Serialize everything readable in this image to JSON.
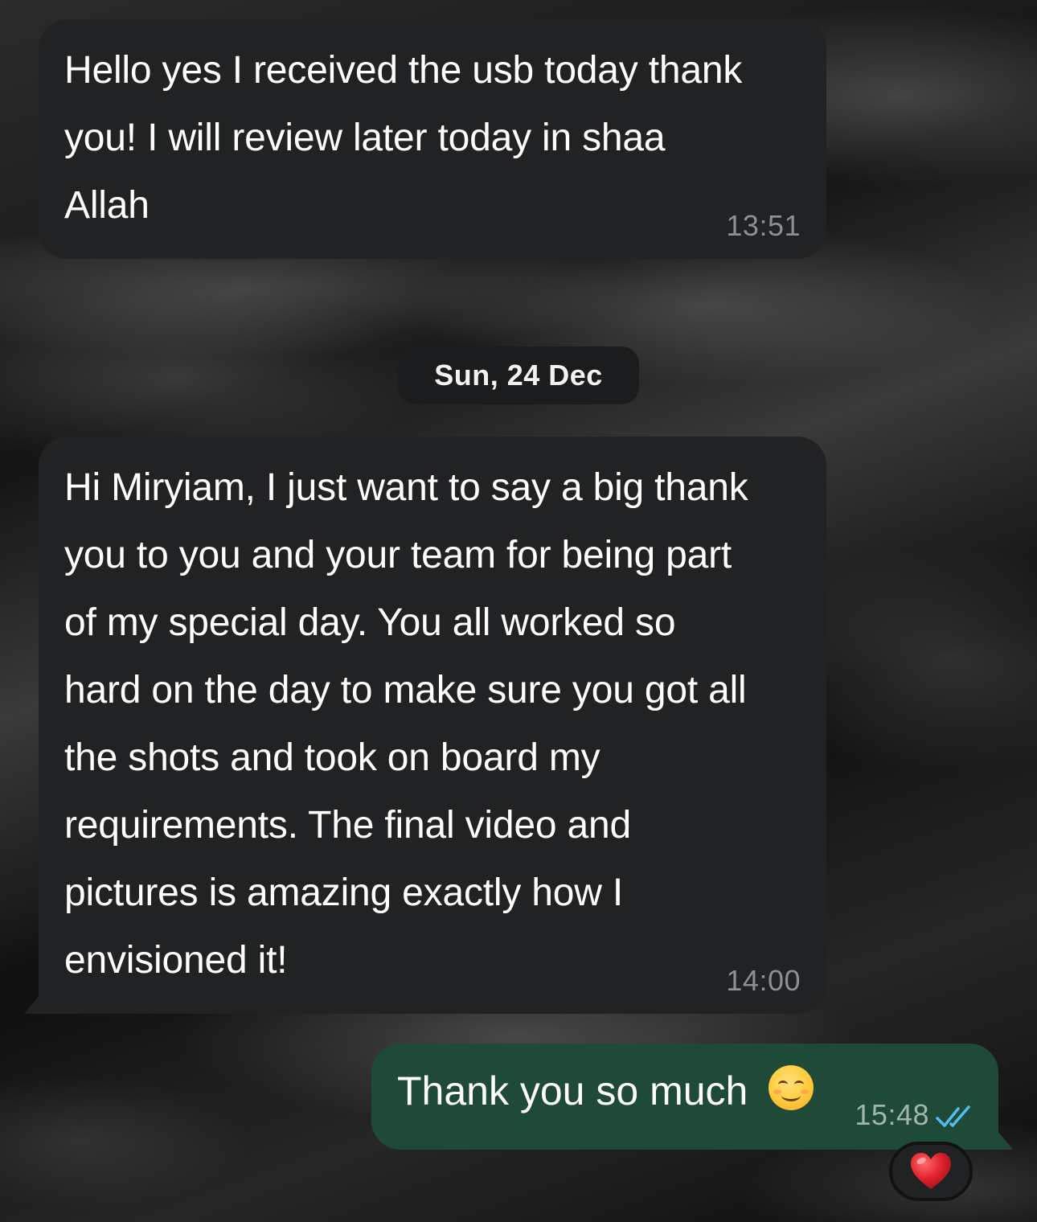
{
  "messages": [
    {
      "direction": "incoming",
      "text": "Hello yes I received the usb today thank\nyou! I will review later today in shaa\nAllah",
      "time": "13:51"
    },
    {
      "direction": "incoming",
      "text": "Hi Miryiam, I just want to say a big thank\nyou to you and your team for being part\nof my special day. You all worked so\nhard on the day to make sure you got all\nthe shots and took on board my\nrequirements. The final video and\npictures is amazing exactly how I\nenvisioned it!",
      "time": "14:00"
    },
    {
      "direction": "outgoing",
      "text": "Thank you so much",
      "emoji": "smiling-face-with-smiling-eyes",
      "time": "15:48",
      "status": "read",
      "reaction": "red-heart"
    }
  ],
  "date_separator": "Sun, 24 Dec",
  "colors": {
    "incoming_bubble": "#202223",
    "outgoing_bubble": "#1f4a37",
    "timestamp": "#8c9093",
    "read_ticks": "#53bdeb",
    "heart": "#e0222e"
  }
}
